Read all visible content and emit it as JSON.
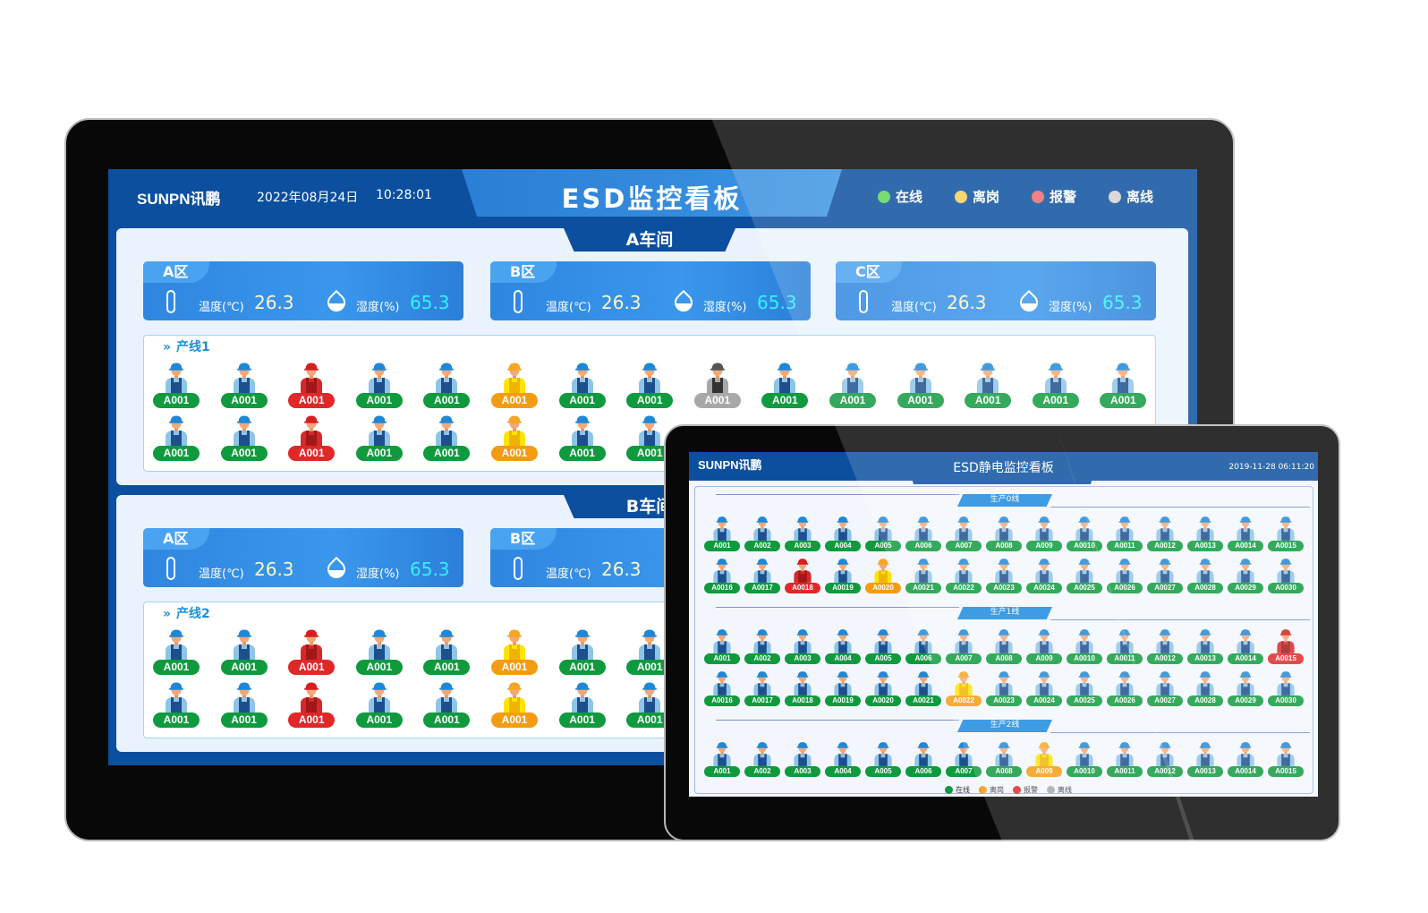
{
  "main_display": {
    "brand": "SUNPN讯鹏",
    "date": "2022年08月24日",
    "time": "10:28:01",
    "title": "ESD监控看板",
    "legend": [
      {
        "label": "在线",
        "color": "#5ed65a"
      },
      {
        "label": "离岗",
        "color": "#f7cf5a"
      },
      {
        "label": "报警",
        "color": "#f06a6a"
      },
      {
        "label": "离线",
        "color": "#d2d2d2"
      }
    ],
    "workshops": [
      {
        "name": "A车间",
        "zones": [
          {
            "name": "A区",
            "temp_label": "温度(℃)",
            "temp": "26.3",
            "hum_label": "湿度(%)",
            "hum": "65.3"
          },
          {
            "name": "B区",
            "temp_label": "温度(℃)",
            "temp": "26.3",
            "hum_label": "湿度(%)",
            "hum": "65.3"
          },
          {
            "name": "C区",
            "temp_label": "温度(℃)",
            "temp": "26.3",
            "hum_label": "湿度(%)",
            "hum": "65.3"
          }
        ],
        "line": {
          "name": "产线1",
          "rows": [
            {
              "ids": [
                "A001",
                "A001",
                "A001",
                "A001",
                "A001",
                "A001",
                "A001",
                "A001",
                "A001",
                "A001",
                "A001",
                "A001",
                "A001",
                "A001",
                "A001"
              ],
              "statuses": [
                "online",
                "online",
                "alarm",
                "online",
                "online",
                "away",
                "online",
                "online",
                "offline",
                "online",
                "online",
                "online",
                "online",
                "online",
                "online"
              ]
            },
            {
              "ids": [
                "A001",
                "A001",
                "A001",
                "A001",
                "A001",
                "A001",
                "A001",
                "A001"
              ],
              "statuses": [
                "online",
                "online",
                "alarm",
                "online",
                "online",
                "away",
                "online",
                "online"
              ]
            }
          ]
        }
      },
      {
        "name": "B车间",
        "zones": [
          {
            "name": "A区",
            "temp_label": "温度(℃)",
            "temp": "26.3",
            "hum_label": "湿度(%)",
            "hum": "65.3"
          },
          {
            "name": "B区",
            "temp_label": "温度(℃)",
            "temp": "26.3"
          }
        ],
        "line": {
          "name": "产线2",
          "rows": [
            {
              "ids": [
                "A001",
                "A001",
                "A001",
                "A001",
                "A001",
                "A001",
                "A001",
                "A001"
              ],
              "statuses": [
                "online",
                "online",
                "alarm",
                "online",
                "online",
                "away",
                "online",
                "online"
              ]
            },
            {
              "ids": [
                "A001",
                "A001",
                "A001",
                "A001",
                "A001",
                "A001",
                "A001",
                "A001"
              ],
              "statuses": [
                "online",
                "online",
                "alarm",
                "online",
                "online",
                "away",
                "online",
                "online"
              ]
            }
          ]
        }
      }
    ]
  },
  "tablet": {
    "brand": "SUNPN讯鹏",
    "title": "ESD静电监控看板",
    "datetime": "2019-11-28 06:11:20",
    "lines": [
      {
        "name": "生产0线",
        "rows": [
          {
            "ids": [
              "A001",
              "A002",
              "A003",
              "A004",
              "A005",
              "A006",
              "A007",
              "A008",
              "A009",
              "A0010",
              "A0011",
              "A0012",
              "A0013",
              "A0014",
              "A0015"
            ],
            "statuses": [
              "online",
              "online",
              "online",
              "online",
              "online",
              "online",
              "online",
              "online",
              "online",
              "online",
              "online",
              "online",
              "online",
              "online",
              "online"
            ]
          },
          {
            "ids": [
              "A0016",
              "A0017",
              "A0018",
              "A0019",
              "A0020",
              "A0021",
              "A0022",
              "A0023",
              "A0024",
              "A0025",
              "A0026",
              "A0027",
              "A0028",
              "A0029",
              "A0030"
            ],
            "statuses": [
              "online",
              "online",
              "alarm",
              "online",
              "away",
              "online",
              "online",
              "online",
              "online",
              "online",
              "online",
              "online",
              "online",
              "online",
              "online"
            ]
          }
        ]
      },
      {
        "name": "生产1线",
        "rows": [
          {
            "ids": [
              "A001",
              "A002",
              "A003",
              "A004",
              "A005",
              "A006",
              "A007",
              "A008",
              "A009",
              "A0010",
              "A0011",
              "A0012",
              "A0013",
              "A0014",
              "A0015"
            ],
            "statuses": [
              "online",
              "online",
              "online",
              "online",
              "online",
              "online",
              "online",
              "online",
              "online",
              "online",
              "online",
              "online",
              "online",
              "online",
              "alarm"
            ]
          },
          {
            "ids": [
              "A0016",
              "A0017",
              "A0018",
              "A0019",
              "A0020",
              "A0021",
              "A0022",
              "A0023",
              "A0024",
              "A0025",
              "A0026",
              "A0027",
              "A0028",
              "A0029",
              "A0030"
            ],
            "statuses": [
              "online",
              "online",
              "online",
              "online",
              "online",
              "online",
              "away",
              "online",
              "online",
              "online",
              "online",
              "online",
              "online",
              "online",
              "online"
            ]
          }
        ]
      },
      {
        "name": "生产2线",
        "rows": [
          {
            "ids": [
              "A001",
              "A002",
              "A003",
              "A004",
              "A005",
              "A006",
              "A007",
              "A008",
              "A009",
              "A0010",
              "A0011",
              "A0012",
              "A0013",
              "A0014",
              "A0015"
            ],
            "statuses": [
              "online",
              "online",
              "online",
              "online",
              "online",
              "online",
              "online",
              "online",
              "away",
              "online",
              "online",
              "online",
              "online",
              "online",
              "online"
            ]
          }
        ]
      }
    ],
    "legend": [
      {
        "label": "在线",
        "color": "#0f9a3e"
      },
      {
        "label": "离岗",
        "color": "#f39c12"
      },
      {
        "label": "报警",
        "color": "#e02828"
      },
      {
        "label": "离线",
        "color": "#a8a8a8"
      }
    ]
  },
  "status_colors": {
    "online": {
      "badge": "#0f9a3e",
      "helmet": "#1e88d8",
      "shirt": "#8ec4e8",
      "overall": "#1d4f8c"
    },
    "alarm": {
      "badge": "#e02828",
      "helmet": "#d42020",
      "shirt": "#d8282a",
      "overall": "#a01818"
    },
    "away": {
      "badge": "#f39c12",
      "helmet": "#f5a623",
      "shirt": "#ffe400",
      "overall": "#f0b400"
    },
    "offline": {
      "badge": "#a8a8a8",
      "helmet": "#555555",
      "shirt": "#a8a8a8",
      "overall": "#333333"
    }
  }
}
